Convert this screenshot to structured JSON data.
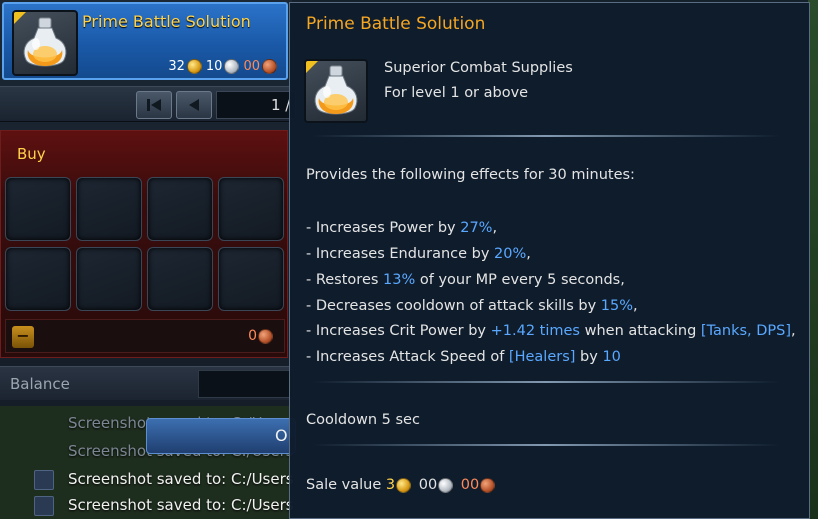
{
  "item": {
    "name": "Prime Battle Solution",
    "price": {
      "gold": "32",
      "silver": "10",
      "copper": "00"
    }
  },
  "pager": {
    "page": "1 /"
  },
  "buy": {
    "title": "Buy",
    "total": "0"
  },
  "balance": {
    "label": "Balance"
  },
  "chat": {
    "lines": [
      "Screenshot saved to: C:/Users",
      "Screenshot saved to: C:/Users",
      "Screenshot saved to: C:/Users",
      "Screenshot saved to: C:/Users"
    ],
    "ok_label": "O"
  },
  "tooltip": {
    "title": "Prime Battle Solution",
    "category": "Superior Combat Supplies",
    "level": "For level 1 or above",
    "intro": "Provides the following effects for 30 minutes:",
    "effects": {
      "e1_pre": "- Increases Power by ",
      "e1_hl": "27%",
      "e1_post": ",",
      "e2_pre": "- Increases Endurance by ",
      "e2_hl": "20%",
      "e2_post": ",",
      "e3_pre": "- Restores ",
      "e3_hl": "13%",
      "e3_post": " of your MP every 5 seconds,",
      "e4_pre": "- Decreases cooldown of attack skills by ",
      "e4_hl": "15%",
      "e4_post": ",",
      "e5_pre": "- Increases Crit Power by ",
      "e5_hl": "+1.42 times",
      "e5_mid": " when attacking ",
      "e5_hl2": "[Tanks, DPS]",
      "e5_post": ",",
      "e6_pre": "- Increases Attack Speed of ",
      "e6_hl": "[Healers]",
      "e6_mid": " by ",
      "e6_hl2": "10"
    },
    "cooldown": "Cooldown  5 sec",
    "sale": {
      "label": "Sale value",
      "gold": "3",
      "silver": "00",
      "copper": "00"
    }
  },
  "colors": {
    "title_orange": "#f5a623",
    "highlight_blue": "#5aa8ff",
    "card_blue": "#2b73c9",
    "buy_red": "#5e1010"
  },
  "icons": [
    "potion-icon",
    "gold-coin-icon",
    "silver-coin-icon",
    "copper-coin-icon",
    "first-page-icon",
    "prev-page-icon",
    "minus-icon"
  ]
}
